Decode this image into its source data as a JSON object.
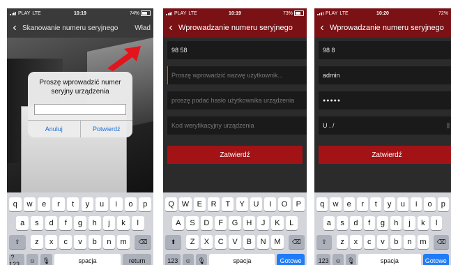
{
  "phone1": {
    "status": {
      "carrier": "PLAY",
      "network": "LTE",
      "time": "10:19",
      "battery": "74%"
    },
    "nav": {
      "title": "Skanowanie numeru seryjnego",
      "right": "Wład"
    },
    "dialog": {
      "message": "Proszę wprowadzić numer seryjny urządzenia",
      "cancel": "Anuluj",
      "confirm": "Potwierdź"
    }
  },
  "phone2": {
    "status": {
      "carrier": "PLAY",
      "network": "LTE",
      "time": "10:19",
      "battery": "73%"
    },
    "nav": {
      "title": "Wprowadzanie numeru seryjnego"
    },
    "form": {
      "serial": "98                58",
      "username_placeholder": "Proszę wprowadzić nazwę użytkownik...",
      "password_placeholder": "proszę podać hasło użytkownika urządzenia",
      "code_placeholder": "Kod weryfikacyjny urządzenia",
      "submit": "Zatwierdź"
    }
  },
  "phone3": {
    "status": {
      "carrier": "PLAY",
      "network": "LTE",
      "time": "10:20",
      "battery": "72%"
    },
    "nav": {
      "title": "Wprowadzanie numeru seryjnego"
    },
    "form": {
      "serial": "98               8",
      "username": "admin",
      "password": "●●●●●",
      "code": "U     .     /",
      "submit": "Zatwierdź"
    }
  },
  "keyboard_lower": {
    "row1": [
      "q",
      "w",
      "e",
      "r",
      "t",
      "y",
      "u",
      "i",
      "o",
      "p"
    ],
    "row2": [
      "a",
      "s",
      "d",
      "f",
      "g",
      "h",
      "j",
      "k",
      "l"
    ],
    "row3": [
      "z",
      "x",
      "c",
      "v",
      "b",
      "n",
      "m"
    ],
    "shift": "⇧",
    "delete": "⌫",
    "numbers": ".?123",
    "emoji": "☺",
    "mic": "🎙",
    "space": "spacja",
    "return": "return"
  },
  "keyboard_upper": {
    "row1": [
      "Q",
      "W",
      "E",
      "R",
      "T",
      "Y",
      "U",
      "I",
      "O",
      "P"
    ],
    "row2": [
      "A",
      "S",
      "D",
      "F",
      "G",
      "H",
      "J",
      "K",
      "L"
    ],
    "row3": [
      "Z",
      "X",
      "C",
      "V",
      "B",
      "N",
      "M"
    ],
    "shift": "⬆",
    "delete": "⌫",
    "numbers": "123",
    "emoji": "☺",
    "mic": "🎙",
    "space": "spacja",
    "return": "Gotowe"
  },
  "keyboard_lower2": {
    "row1": [
      "q",
      "w",
      "e",
      "r",
      "t",
      "y",
      "u",
      "i",
      "o",
      "p"
    ],
    "row2": [
      "a",
      "s",
      "d",
      "f",
      "g",
      "h",
      "j",
      "k",
      "l"
    ],
    "row3": [
      "z",
      "x",
      "c",
      "v",
      "b",
      "n",
      "m"
    ],
    "shift": "⇧",
    "delete": "⌫",
    "numbers": "123",
    "emoji": "☺",
    "mic": "🎙",
    "space": "spacja",
    "return": "Gotowe"
  },
  "colors": {
    "accent_red": "#a31316",
    "nav_red": "#7a1114",
    "ios_blue": "#1f7cf6",
    "arrow_red": "#e3141b"
  }
}
